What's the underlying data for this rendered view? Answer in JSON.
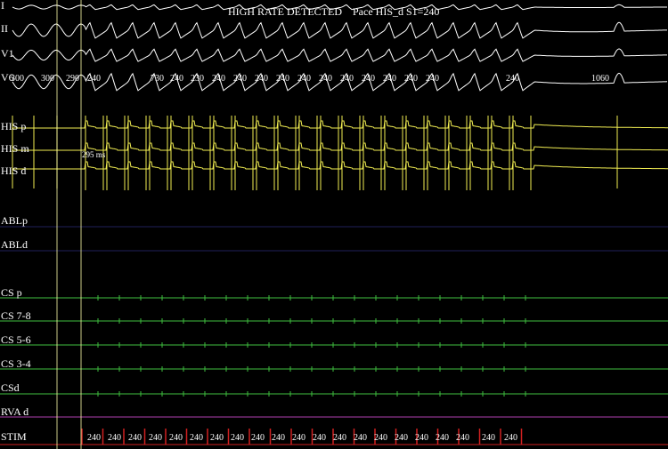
{
  "header": {
    "status": "HIGH RATE DETECTED",
    "pacing": "Pace HIS_d S1=240"
  },
  "channels": [
    {
      "key": "I",
      "label": "I"
    },
    {
      "key": "II",
      "label": "II"
    },
    {
      "key": "V1",
      "label": "V1"
    },
    {
      "key": "V6",
      "label": "V6"
    },
    {
      "key": "HISp",
      "label": "HIS p"
    },
    {
      "key": "HISm",
      "label": "HIS m"
    },
    {
      "key": "HISd",
      "label": "HIS d"
    },
    {
      "key": "ABLp",
      "label": "ABLp"
    },
    {
      "key": "ABLd",
      "label": "ABLd"
    },
    {
      "key": "CSp",
      "label": "CS p"
    },
    {
      "key": "CS78",
      "label": "CS 7-8"
    },
    {
      "key": "CS56",
      "label": "CS 5-6"
    },
    {
      "key": "CS34",
      "label": "CS 3-4"
    },
    {
      "key": "CSd",
      "label": "CSd"
    },
    {
      "key": "RVAd",
      "label": "RVA d"
    },
    {
      "key": "STIM",
      "label": "STIM"
    }
  ],
  "v6_intervals": [
    "300",
    "300",
    "290",
    "240",
    "730",
    "240",
    "230",
    "240",
    "240",
    "240",
    "240",
    "240",
    "240",
    "240",
    "240",
    "240",
    "240",
    "240",
    "240",
    "1060"
  ],
  "measurement": "295 ms",
  "stim_intervals": [
    "240",
    "240",
    "240",
    "240",
    "240",
    "240",
    "240",
    "240",
    "240",
    "240",
    "240",
    "240",
    "240",
    "240",
    "240",
    "240",
    "240",
    "240",
    "240",
    "240",
    "240"
  ],
  "colors": {
    "ecg": "#ffffff",
    "his": "#f2ee52",
    "abl_baseline": "#20205a",
    "cs": "#3fbf3f",
    "rva": "#b03fb0",
    "stim": "#d02020",
    "caliper": "#ffffaa"
  }
}
